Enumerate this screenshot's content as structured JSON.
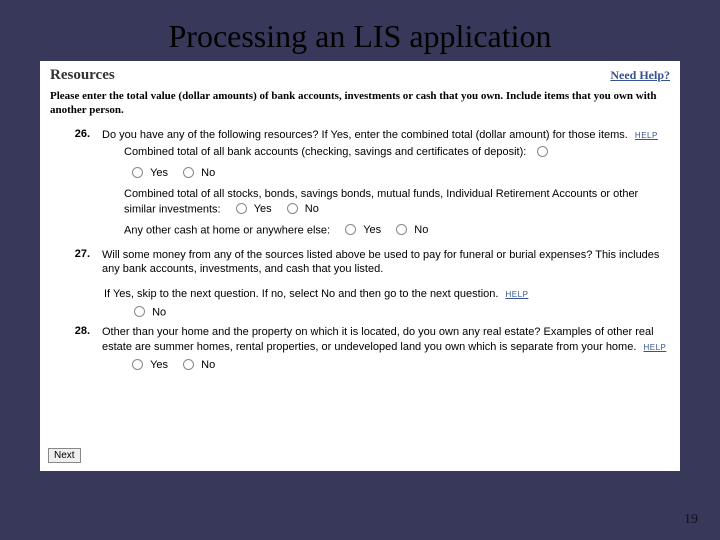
{
  "title": "Processing an LIS application",
  "panel": {
    "resources_title": "Resources",
    "need_help": "Need Help?",
    "instructions": "Please enter the total value (dollar amounts) of bank accounts, investments or cash that you own. Include items that you own with another person.",
    "q26": {
      "num": "26.",
      "text": "Do you have any of the following resources? If Yes, enter the combined total (dollar amount) for those items.",
      "help": "HELP",
      "line_bank": "Combined total of all bank accounts (checking, savings and certificates of deposit):",
      "line_stocks": "Combined total of all stocks, bonds, savings bonds, mutual funds, Individual Retirement Accounts or other similar investments:",
      "line_cash": "Any other cash at home or anywhere else:",
      "yes": "Yes",
      "no": "No"
    },
    "q27": {
      "num": "27.",
      "text": "Will some money from any of the sources listed above be used to pay for funeral or burial expenses? This includes any bank accounts, investments, and cash that you listed.",
      "skip": "If Yes, skip to the next question. If no, select No and then go to the next question.",
      "help": "HELP",
      "no": "No"
    },
    "q28": {
      "num": "28.",
      "text": "Other than your home and the property on which it is located, do you own any real estate? Examples of other real estate are summer homes, rental properties, or undeveloped land you own which is separate from your home.",
      "help": "HELP",
      "yes": "Yes",
      "no": "No"
    },
    "next": "Next"
  },
  "page_number": "19"
}
